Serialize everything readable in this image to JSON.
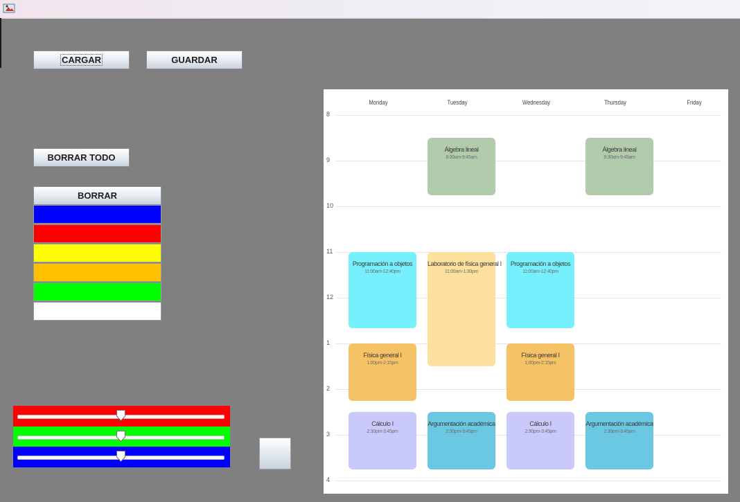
{
  "toolbar": {
    "load_label": "CARGAR",
    "save_label": "GUARDAR",
    "clear_all_label": "BORRAR TODO"
  },
  "palette": {
    "erase_label": "BORRAR",
    "colors": [
      "#0000ff",
      "#ff0000",
      "#ffff00",
      "#ffc000",
      "#00ff00",
      "#ffffff"
    ]
  },
  "rgb_sliders": {
    "red": {
      "color": "#ff0000",
      "value": 0.5
    },
    "green": {
      "color": "#00ff00",
      "value": 0.5
    },
    "blue": {
      "color": "#0000ff",
      "value": 0.5
    }
  },
  "calendar": {
    "days": [
      "Monday",
      "Tuesday",
      "Wednesday",
      "Thursday",
      "Friday"
    ],
    "hours": [
      "8",
      "9",
      "10",
      "11",
      "12",
      "1",
      "2",
      "3",
      "4"
    ],
    "events": [
      {
        "title": "Álgebra lineal",
        "time": "8:30am-9:45am",
        "day": 1,
        "color": "#b2cbad"
      },
      {
        "title": "Álgebra lineal",
        "time": "8:30am-9:45am",
        "day": 3,
        "color": "#b2cbad"
      },
      {
        "title": "Programación a objetos",
        "time": "11:00am-12:40pm",
        "day": 0,
        "color": "#76f0fc"
      },
      {
        "title": "Laboratorio de física general I",
        "time": "11:00am-1:30pm",
        "day": 1,
        "color": "#fddf9e"
      },
      {
        "title": "Programación a objetos",
        "time": "11:00am-12:40pm",
        "day": 2,
        "color": "#76f0fc"
      },
      {
        "title": "Física general I",
        "time": "1:00pm-2:15pm",
        "day": 0,
        "color": "#f5c265"
      },
      {
        "title": "Física general I",
        "time": "1:00pm-2:15pm",
        "day": 2,
        "color": "#f5c265"
      },
      {
        "title": "Cálculo I",
        "time": "2:30pm-3:45pm",
        "day": 0,
        "color": "#c9c9fb"
      },
      {
        "title": "Argumentación académica",
        "time": "2:30pm-3:45pm",
        "day": 1,
        "color": "#6ac8e3"
      },
      {
        "title": "Cálculo I",
        "time": "2:30pm-3:45pm",
        "day": 2,
        "color": "#c9c9fb"
      },
      {
        "title": "Argumentación académica",
        "time": "2:30pm-3:45pm",
        "day": 3,
        "color": "#6ac8e3"
      }
    ]
  }
}
